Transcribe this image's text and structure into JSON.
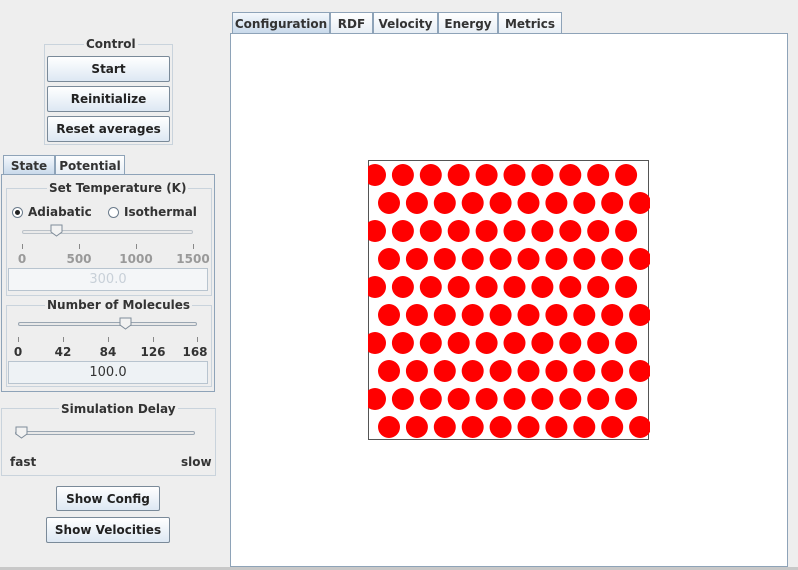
{
  "control": {
    "title": "Control",
    "start": "Start",
    "reinitialize": "Reinitialize",
    "reset_averages": "Reset averages"
  },
  "left_tabs": [
    "State",
    "Potential"
  ],
  "temperature": {
    "title": "Set Temperature (K)",
    "adiabatic": "Adiabatic",
    "isothermal": "Isothermal",
    "selected_mode": "Adiabatic",
    "ticks": [
      "0",
      "500",
      "1000",
      "1500"
    ],
    "min": 0,
    "max": 1500,
    "value": 300,
    "field_value": "300.0"
  },
  "molecules": {
    "title": "Number of Molecules",
    "ticks": [
      "0",
      "42",
      "84",
      "126",
      "168"
    ],
    "min": 0,
    "max": 168,
    "value": 100,
    "field_value": "100.0"
  },
  "delay": {
    "title": "Simulation Delay",
    "fast": "fast",
    "slow": "slow",
    "value_fraction": 0
  },
  "buttons": {
    "show_config": "Show Config",
    "show_velocities": "Show Velocities"
  },
  "main_tabs": [
    "Configuration",
    "RDF",
    "Velocity",
    "Energy",
    "Metrics"
  ],
  "selected_main_tab": "Configuration",
  "simulation": {
    "rows": 10,
    "molecule_count": 100,
    "molecule_color": "#ff0000"
  },
  "colors": {
    "tab_selected": "#c7d8ea",
    "border": "#8ea3b8"
  }
}
